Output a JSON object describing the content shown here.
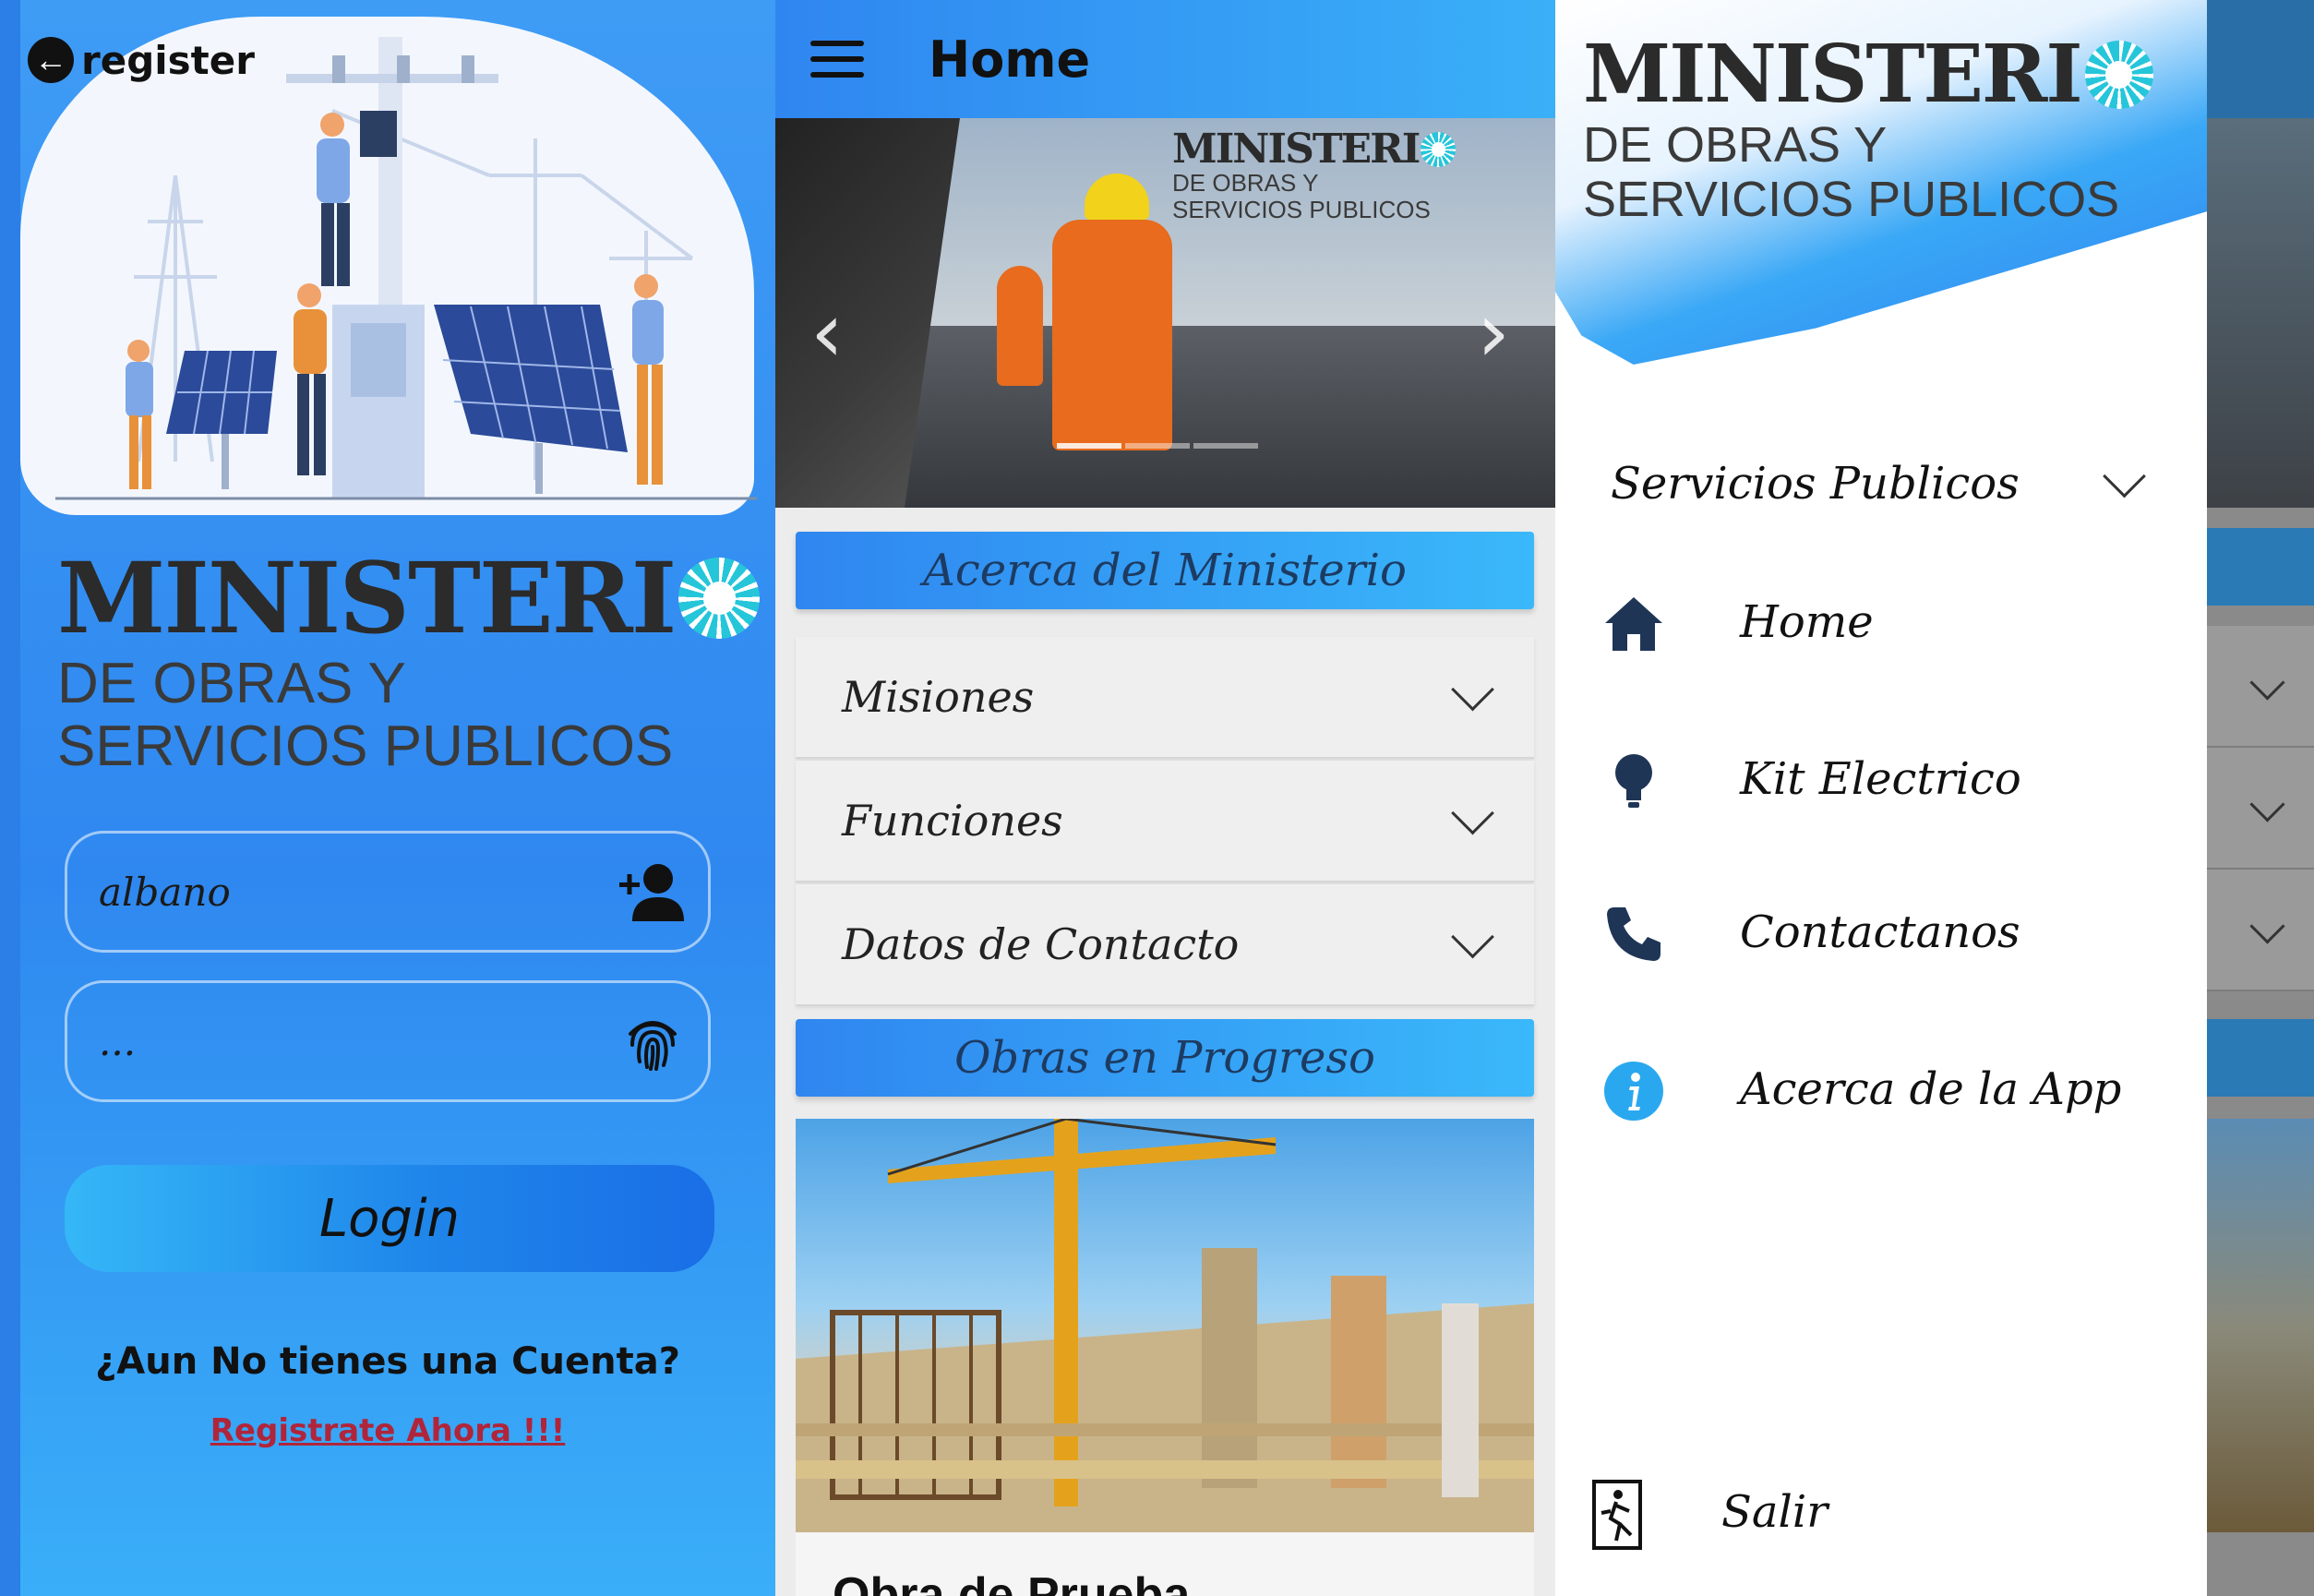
{
  "login": {
    "back_label": "register",
    "logo_main": "MINISTERI",
    "logo_line1": "DE OBRAS Y",
    "logo_line2": "SERVICIOS PUBLICOS",
    "username_value": "albano",
    "password_value": "...",
    "login_label": "Login",
    "question": "¿Aun No tienes una Cuenta?",
    "register_link": "Registrate Ahora !!!",
    "icons": [
      "arrow-left-icon",
      "add-user-icon",
      "fingerprint-icon"
    ]
  },
  "home": {
    "title": "Home",
    "hero_logo_main": "MINISTERI",
    "hero_logo_line1": "DE OBRAS Y",
    "hero_logo_line2": "SERVICIOS PUBLICOS",
    "carousel_active": 1,
    "carousel_count": 3,
    "section1": "Acerca del Ministerio",
    "accordion": [
      "Misiones",
      "Funciones",
      "Datos de Contacto"
    ],
    "section2": "Obras en Progreso",
    "card_title": "Obra de Prueba"
  },
  "drawer": {
    "logo_main": "MINISTERI",
    "logo_line1": "DE OBRAS Y",
    "logo_line2": "SERVICIOS PUBLICOS",
    "group": "Servicios Publicos",
    "items": [
      {
        "label": "Home",
        "icon": "home-icon",
        "color": "#1f3556"
      },
      {
        "label": "Kit Electrico",
        "icon": "lightbulb-icon",
        "color": "#1f3556"
      },
      {
        "label": "Contactanos",
        "icon": "phone-icon",
        "color": "#1f3556"
      },
      {
        "label": "Acerca de la App",
        "icon": "info-icon",
        "color": "#29a8f0"
      }
    ],
    "logout": "Salir"
  },
  "colors": {
    "primary_blue": "#2f86f0",
    "light_blue": "#3ab0f8",
    "logo_dark": "#2b2b2b",
    "logo_accent": "#26c6da",
    "link_red": "#b0253a"
  }
}
